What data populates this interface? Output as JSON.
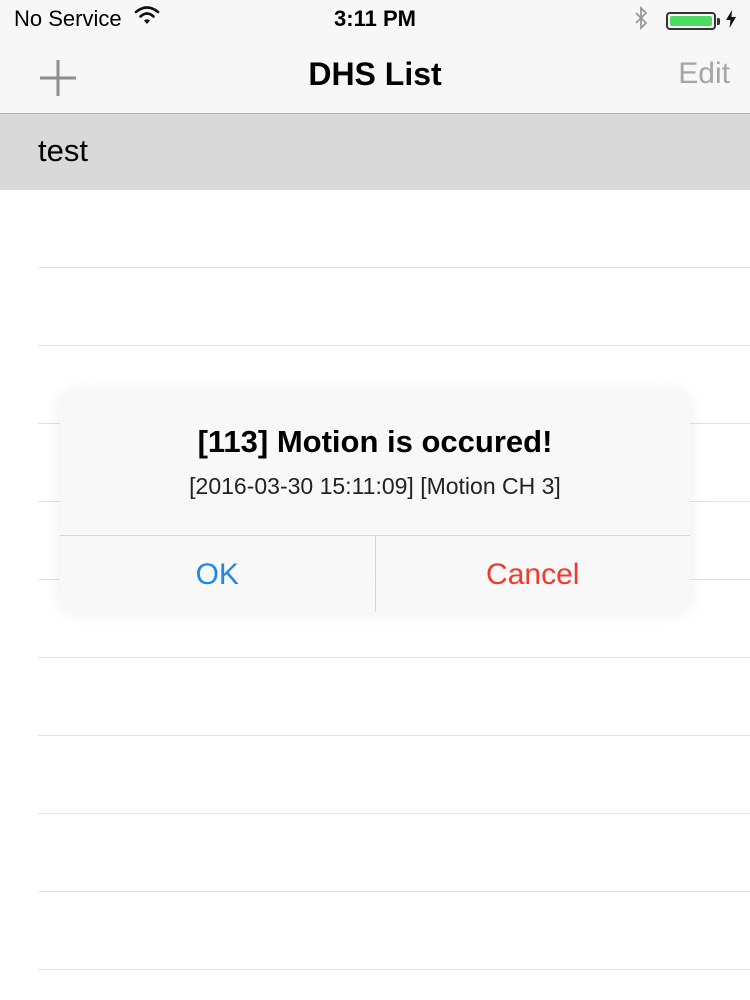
{
  "status_bar": {
    "carrier": "No Service",
    "time": "3:11 PM",
    "battery_level": 1.0,
    "colors": {
      "battery_fill": "#4cd964"
    },
    "icons": [
      "wifi-icon",
      "bluetooth-icon",
      "battery-icon",
      "charging-icon"
    ]
  },
  "nav": {
    "title": "DHS List",
    "add_icon": "plus-icon",
    "edit_label": "Edit"
  },
  "list": {
    "items": [
      {
        "label": "test",
        "selected": true
      }
    ]
  },
  "alert": {
    "title": "[113] Motion is occured!",
    "message": "[2016-03-30 15:11:09] [Motion CH 3]",
    "ok_label": "OK",
    "cancel_label": "Cancel",
    "colors": {
      "ok": "#1e88e5",
      "cancel": "#ef3b2f"
    }
  }
}
